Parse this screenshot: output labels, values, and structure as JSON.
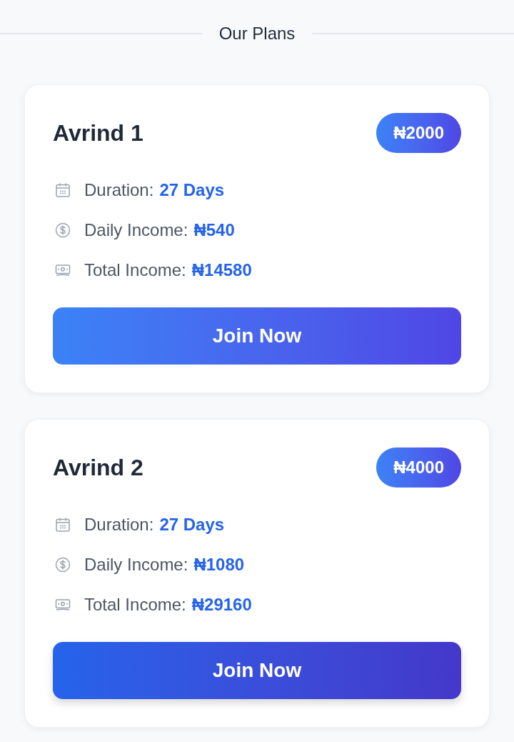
{
  "section_title": "Our Plans",
  "plans": [
    {
      "name": "Avrind 1",
      "price": "₦2000",
      "details": [
        {
          "kind": "duration",
          "label": "Duration:",
          "value": "27 Days"
        },
        {
          "kind": "daily",
          "label": "Daily Income:",
          "value": "₦540"
        },
        {
          "kind": "total",
          "label": "Total Income:",
          "value": "₦14580"
        }
      ],
      "button": {
        "label": "Join Now",
        "hovered": false
      }
    },
    {
      "name": "Avrind 2",
      "price": "₦4000",
      "details": [
        {
          "kind": "duration",
          "label": "Duration:",
          "value": "27 Days"
        },
        {
          "kind": "daily",
          "label": "Daily Income:",
          "value": "₦1080"
        },
        {
          "kind": "total",
          "label": "Total Income:",
          "value": "₦29160"
        }
      ],
      "button": {
        "label": "Join Now",
        "hovered": true
      }
    }
  ]
}
